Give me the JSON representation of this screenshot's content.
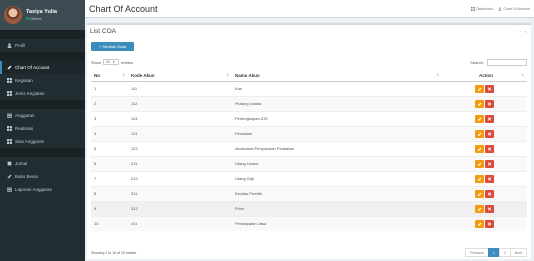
{
  "user": {
    "name": "Tasiya Yulia",
    "status": "Online"
  },
  "sidebar": {
    "items": [
      {
        "type": "header",
        "label": ""
      },
      {
        "type": "item",
        "label": "Profil",
        "icon": "user-icon"
      },
      {
        "type": "header",
        "label": ""
      },
      {
        "type": "item",
        "label": "Chart Of Account",
        "icon": "pencil-icon",
        "active": true
      },
      {
        "type": "item",
        "label": "Kegiatan",
        "icon": "grid-icon"
      },
      {
        "type": "item",
        "label": "Jenis Kegiatan",
        "icon": "grid-icon"
      },
      {
        "type": "header",
        "label": ""
      },
      {
        "type": "item",
        "label": "Anggaran",
        "icon": "list-icon"
      },
      {
        "type": "item",
        "label": "Realisasi",
        "icon": "grid-icon"
      },
      {
        "type": "item",
        "label": "Sisa Anggaran",
        "icon": "grid-icon"
      },
      {
        "type": "header",
        "label": ""
      },
      {
        "type": "item",
        "label": "Jurnal",
        "icon": "book-icon"
      },
      {
        "type": "item",
        "label": "Buku Besar",
        "icon": "pencil-icon"
      },
      {
        "type": "item",
        "label": "Laporan Anggaran",
        "icon": "list-icon"
      }
    ]
  },
  "header": {
    "title": "Chart Of Account",
    "breadcrumb": [
      "Dashboard",
      "Chart Of Account"
    ]
  },
  "box": {
    "title": "List COA",
    "add_label": "Tambah Data",
    "length_prefix": "Show",
    "length_value": "10",
    "length_suffix": "entries",
    "search_label": "Search:"
  },
  "table": {
    "columns": [
      "No",
      "Kode Akun",
      "Nama Akun",
      "Action"
    ],
    "rows": [
      {
        "no": "1",
        "kode": "111",
        "nama": "Kas"
      },
      {
        "no": "2",
        "kode": "112",
        "nama": "Piutang Usaha"
      },
      {
        "no": "3",
        "kode": "113",
        "nama": "Perlengkapan ATK"
      },
      {
        "no": "4",
        "kode": "121",
        "nama": "Peralatan"
      },
      {
        "no": "5",
        "kode": "122",
        "nama": "Akumulasi Penyusutan Peralatan"
      },
      {
        "no": "6",
        "kode": "211",
        "nama": "Utang Usaha"
      },
      {
        "no": "7",
        "kode": "212",
        "nama": "Utang Gaji"
      },
      {
        "no": "8",
        "kode": "311",
        "nama": "Ekuitas Pemilik"
      },
      {
        "no": "9",
        "kode": "312",
        "nama": "Prive"
      },
      {
        "no": "10",
        "kode": "411",
        "nama": "Pendapatan Jasa"
      }
    ]
  },
  "footer": {
    "info": "Showing 1 to 10 of 20 entries",
    "pager": [
      "Previous",
      "1",
      "2",
      "Next"
    ],
    "current_page": "1"
  },
  "colors": {
    "sidebar": "#222d32",
    "primary": "#3c8dbc",
    "edit": "#f39c12",
    "delete": "#dd4b39"
  }
}
